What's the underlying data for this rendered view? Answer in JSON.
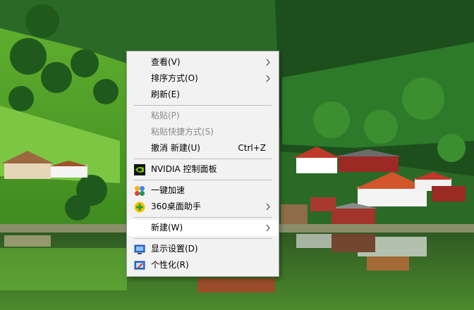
{
  "desktop": {
    "wallpaper": "lake-village-landscape",
    "colors": {
      "sky_grass": "#6fbf3a",
      "forest": "#1f5a22",
      "water": "#3d6a2c"
    }
  },
  "menu": {
    "items": [
      {
        "id": "view",
        "label": "查看(V)",
        "submenu": true
      },
      {
        "id": "sort",
        "label": "排序方式(O)",
        "submenu": true
      },
      {
        "id": "refresh",
        "label": "刷新(E)"
      },
      {
        "id": "paste",
        "label": "粘贴(P)",
        "disabled": true
      },
      {
        "id": "paste-shortcut",
        "label": "粘贴快捷方式(S)",
        "disabled": true
      },
      {
        "id": "undo",
        "label": "撤消 新建(U)",
        "shortcut": "Ctrl+Z"
      },
      {
        "id": "nvidia",
        "label": "NVIDIA 控制面板",
        "icon": "nvidia-icon"
      },
      {
        "id": "speedup",
        "label": "一键加速",
        "icon": "speedup-icon"
      },
      {
        "id": "desk360",
        "label": "360桌面助手",
        "icon": "360-icon",
        "submenu": true
      },
      {
        "id": "new",
        "label": "新建(W)",
        "submenu": true,
        "highlighted": true
      },
      {
        "id": "display",
        "label": "显示设置(D)",
        "icon": "display-icon"
      },
      {
        "id": "personalize",
        "label": "个性化(R)",
        "icon": "personalize-icon"
      }
    ]
  }
}
